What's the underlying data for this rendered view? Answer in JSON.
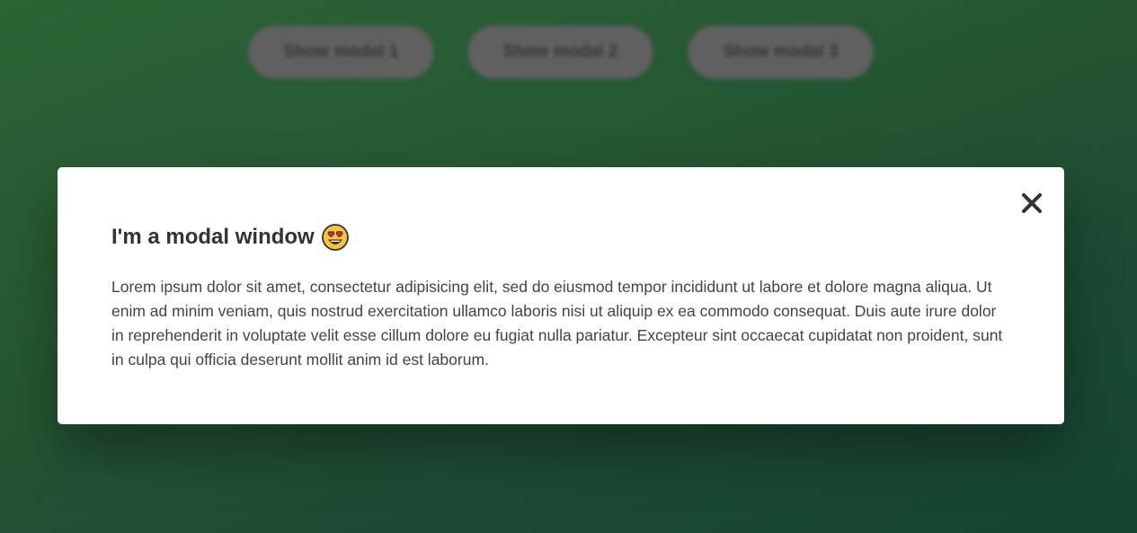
{
  "buttons": [
    {
      "label": "Show modal 1"
    },
    {
      "label": "Show modal 2"
    },
    {
      "label": "Show modal 3"
    }
  ],
  "modal": {
    "title": "I'm a modal window",
    "title_emoji_icon": "heart-eyes-emoji-icon",
    "close_icon": "close-icon",
    "body": "Lorem ipsum dolor sit amet, consectetur adipisicing elit, sed do eiusmod tempor incididunt ut labore et dolore magna aliqua. Ut enim ad minim veniam, quis nostrud exercitation ullamco laboris nisi ut aliquip ex ea commodo consequat. Duis aute irure dolor in reprehenderit in voluptate velit esse cillum dolore eu fugiat nulla pariatur. Excepteur sint occaecat cupidatat non proident, sunt in culpa qui officia deserunt mollit anim id est laborum."
  },
  "colors": {
    "background_gradient": [
      "#2f6a38",
      "#174836"
    ],
    "button_bg": "#666666",
    "modal_bg": "#ffffff",
    "text": "#333333"
  }
}
